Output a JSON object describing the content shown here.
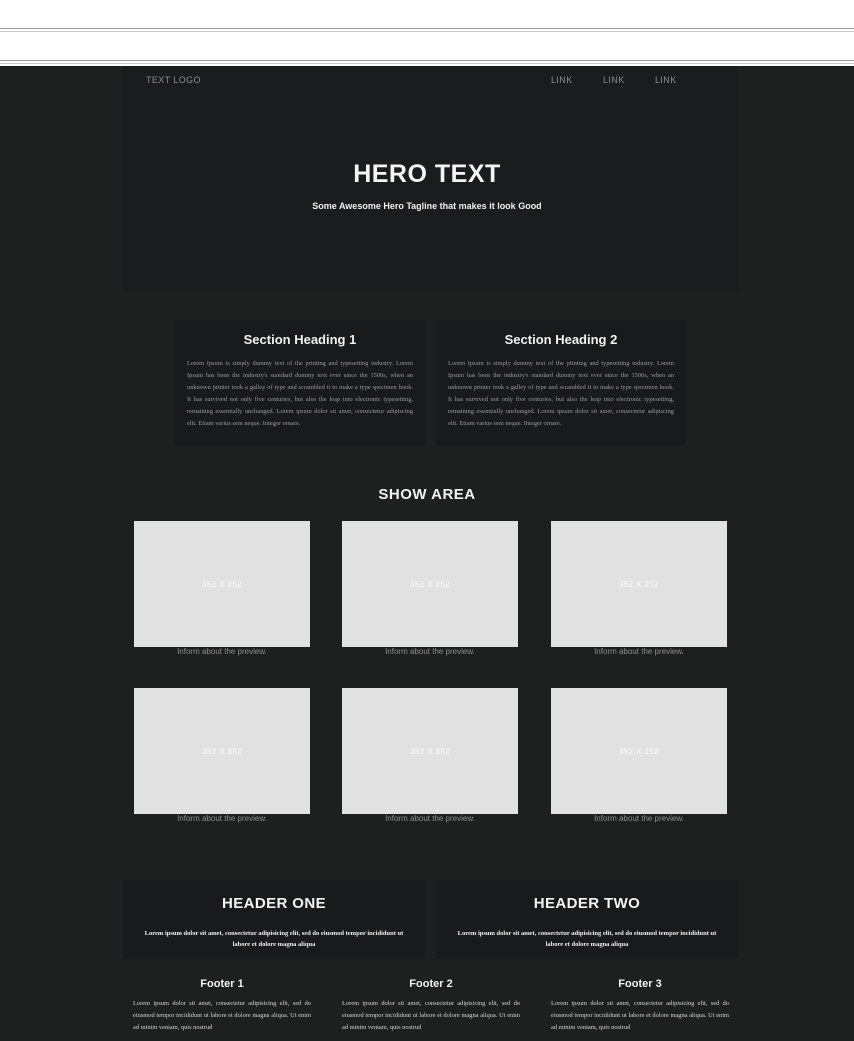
{
  "nav": {
    "logo": "TEXT LOGO",
    "links": [
      "LINK",
      "LINK",
      "LINK"
    ]
  },
  "hero": {
    "title": "HERO TEXT",
    "tagline": "Some Awesome Hero Tagline that makes it look Good"
  },
  "sections": [
    {
      "heading": "Section Heading 1",
      "body": "Lorem Ipsum is simply dummy text of the printing and typesetting industry. Lorem Ipsum has been the industry's standard dummy text ever since the 1500s, when an unknown printer took a galley of type and scrambled it to make a type specimen book. It has survived not only five centuries, but also the leap into electronic typesetting, remaining essentially unchanged. Lorem ipsum dolor sit amet, consectetur adipiscing elit. Etiam varius sem neque. Integer ornare."
    },
    {
      "heading": "Section Heading 2",
      "body": "Lorem Ipsum is simply dummy text of the printing and typesetting industry. Lorem Ipsum has been the industry's standard dummy text ever since the 1500s, when an unknown printer took a galley of type and scrambled it to make a type specimen book. It has survived not only five centuries, but also the leap into electronic typesetting, remaining essentially unchanged. Lorem ipsum dolor sit amet, consectetur adipiscing elit. Etiam varius sem neque. Integer ornare."
    }
  ],
  "show_area": {
    "title": "SHOW AREA",
    "items": [
      {
        "placeholder": "352 X 252",
        "caption": "Inform about the preview."
      },
      {
        "placeholder": "352 X 252",
        "caption": "Inform about the preview."
      },
      {
        "placeholder": "352 X 252",
        "caption": "Inform about the preview."
      },
      {
        "placeholder": "352 X 252",
        "caption": "Inform about the preview."
      },
      {
        "placeholder": "352 X 252",
        "caption": "Inform about the preview."
      },
      {
        "placeholder": "352 X 252",
        "caption": "Inform about the preview."
      }
    ]
  },
  "headers": [
    {
      "title": "HEADER ONE",
      "body": "Lorem ipsum dolor sit amet, consectetur adipisicing elit, sed do eiusmod tempor incididunt ut labore et dolore magna aliqua"
    },
    {
      "title": "HEADER TWO",
      "body": "Lorem ipsum dolor sit amet, consectetur adipisicing elit, sed do eiusmod tempor incididunt ut labore et dolore magna aliqua"
    }
  ],
  "footers": [
    {
      "title": "Footer 1",
      "body": "Lorem ipsum dolor sit amet, consectetur adipisicing elit, sed do eiusmod tempor incididunt ut labore et dolore magna aliqua. Ut enim ad minim veniam, quis nostrud"
    },
    {
      "title": "Footer 2",
      "body": "Lorem ipsum dolor sit amet, consectetur adipisicing elit, sed do eiusmod tempor incididunt ut labore et dolore magna aliqua. Ut enim ad minim veniam, quis nostrud"
    },
    {
      "title": "Footer 3",
      "body": "Lorem ipsum dolor sit amet, consectetur adipisicing elit, sed do eiusmod tempor incididunt ut labore et dolore magna aliqua. Ut enim ad minim veniam, quis nostrud"
    }
  ]
}
